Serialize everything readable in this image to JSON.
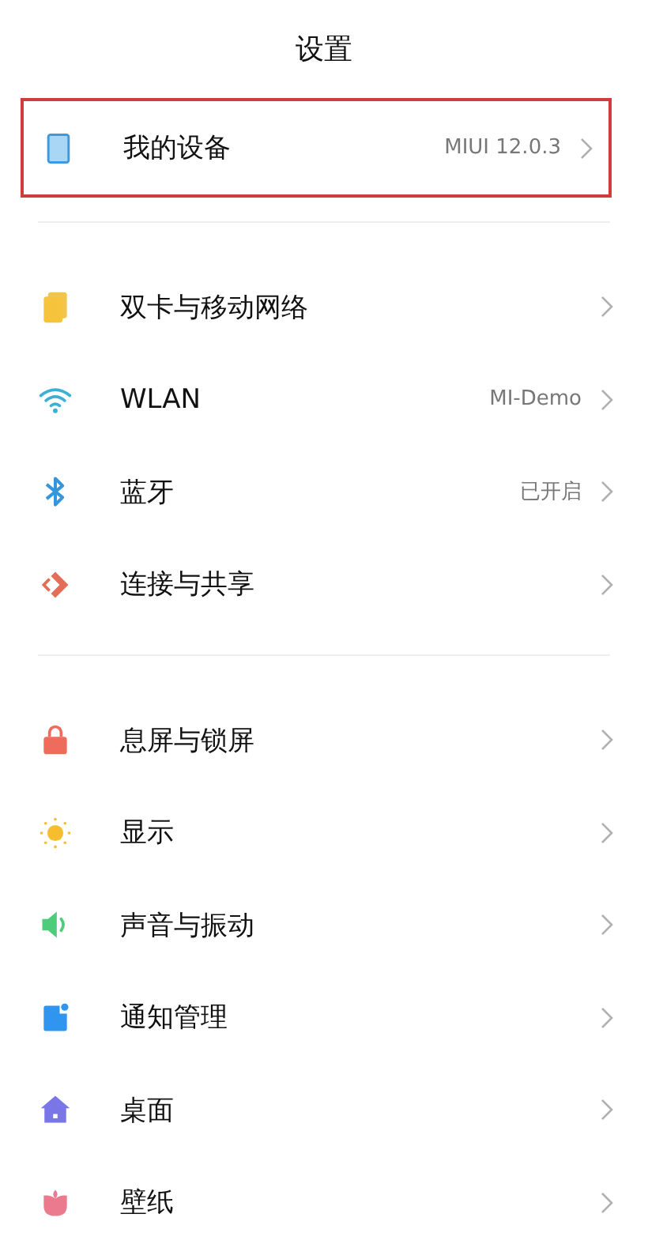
{
  "title": "设置",
  "sections": [
    {
      "items": [
        {
          "kind": "device",
          "label": "我的设备",
          "value": "MIUI 12.0.3",
          "highlighted": true
        }
      ]
    },
    {
      "items": [
        {
          "kind": "sim",
          "label": "双卡与移动网络",
          "highlighted": false
        },
        {
          "kind": "wifi",
          "label": "WLAN",
          "value": "MI-Demo",
          "highlighted": false
        },
        {
          "kind": "bluetooth",
          "label": "蓝牙",
          "value": "已开启",
          "highlighted": false
        },
        {
          "kind": "share",
          "label": "连接与共享",
          "highlighted": false
        }
      ]
    },
    {
      "items": [
        {
          "kind": "lock",
          "label": "息屏与锁屏",
          "highlighted": false
        },
        {
          "kind": "sun",
          "label": "显示",
          "highlighted": false
        },
        {
          "kind": "speaker",
          "label": "声音与振动",
          "highlighted": false
        },
        {
          "kind": "notification",
          "label": "通知管理",
          "highlighted": false
        },
        {
          "kind": "home",
          "label": "桌面",
          "highlighted": false
        },
        {
          "kind": "flower",
          "label": "壁纸",
          "highlighted": false
        }
      ]
    }
  ]
}
